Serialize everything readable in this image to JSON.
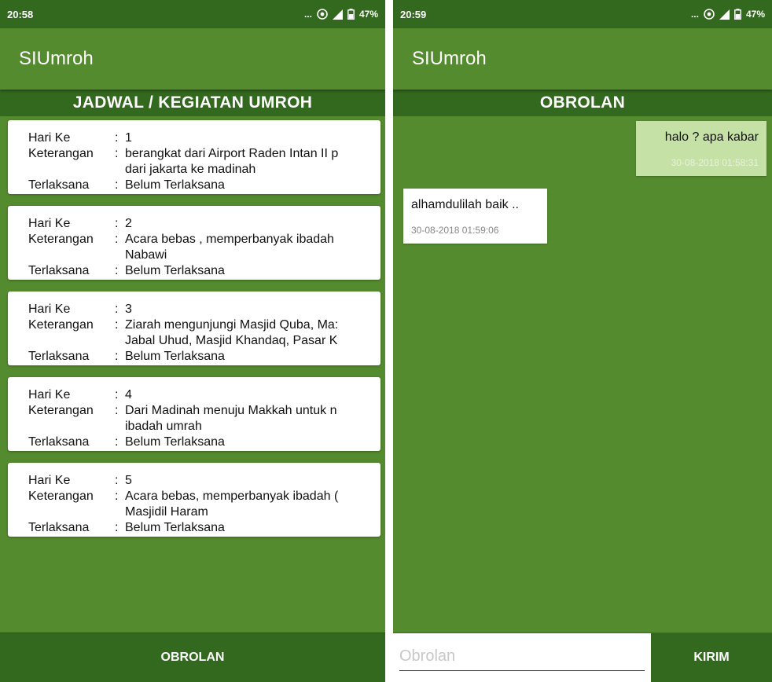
{
  "left": {
    "status": {
      "time": "20:58",
      "dots": "...",
      "battery": "47%"
    },
    "app_title": "SIUmroh",
    "section_title": "JADWAL / KEGIATAN UMROH",
    "labels": {
      "day": "Hari Ke",
      "description": "Keterangan",
      "done": "Terlaksana",
      "sep": ":"
    },
    "cards": [
      {
        "day": "1",
        "desc1": "berangkat dari Airport Raden Intan II p",
        "desc2": "dari jakarta ke madinah",
        "done": "Belum Terlaksana"
      },
      {
        "day": "2",
        "desc1": "Acara bebas , memperbanyak ibadah",
        "desc2": "Nabawi",
        "done": "Belum Terlaksana"
      },
      {
        "day": "3",
        "desc1": "Ziarah mengunjungi Masjid Quba, Ma:",
        "desc2": "Jabal Uhud, Masjid Khandaq, Pasar K",
        "done": "Belum Terlaksana"
      },
      {
        "day": "4",
        "desc1": "Dari Madinah menuju Makkah untuk n",
        "desc2": "ibadah umrah",
        "done": "Belum Terlaksana"
      },
      {
        "day": "5",
        "desc1": "Acara bebas, memperbanyak ibadah (",
        "desc2": "Masjidil Haram",
        "done": "Belum Terlaksana"
      }
    ],
    "bottom_button": "OBROLAN"
  },
  "right": {
    "status": {
      "time": "20:59",
      "dots": "...",
      "battery": "47%"
    },
    "app_title": "SIUmroh",
    "section_title": "OBROLAN",
    "messages": [
      {
        "text": "halo ? apa kabar",
        "time": "30-08-2018 01:58:31"
      },
      {
        "text": "alhamdulilah baik ..",
        "time": "30-08-2018 01:59:06"
      }
    ],
    "input_placeholder": "Obrolan",
    "send_button": "KIRIM"
  },
  "colors": {
    "primary": "#558B2F",
    "primary_dark": "#33691E",
    "outgoing_bubble": "#C5E1A5"
  },
  "icons": [
    "wifi-icon",
    "signal-icon",
    "battery-icon"
  ]
}
